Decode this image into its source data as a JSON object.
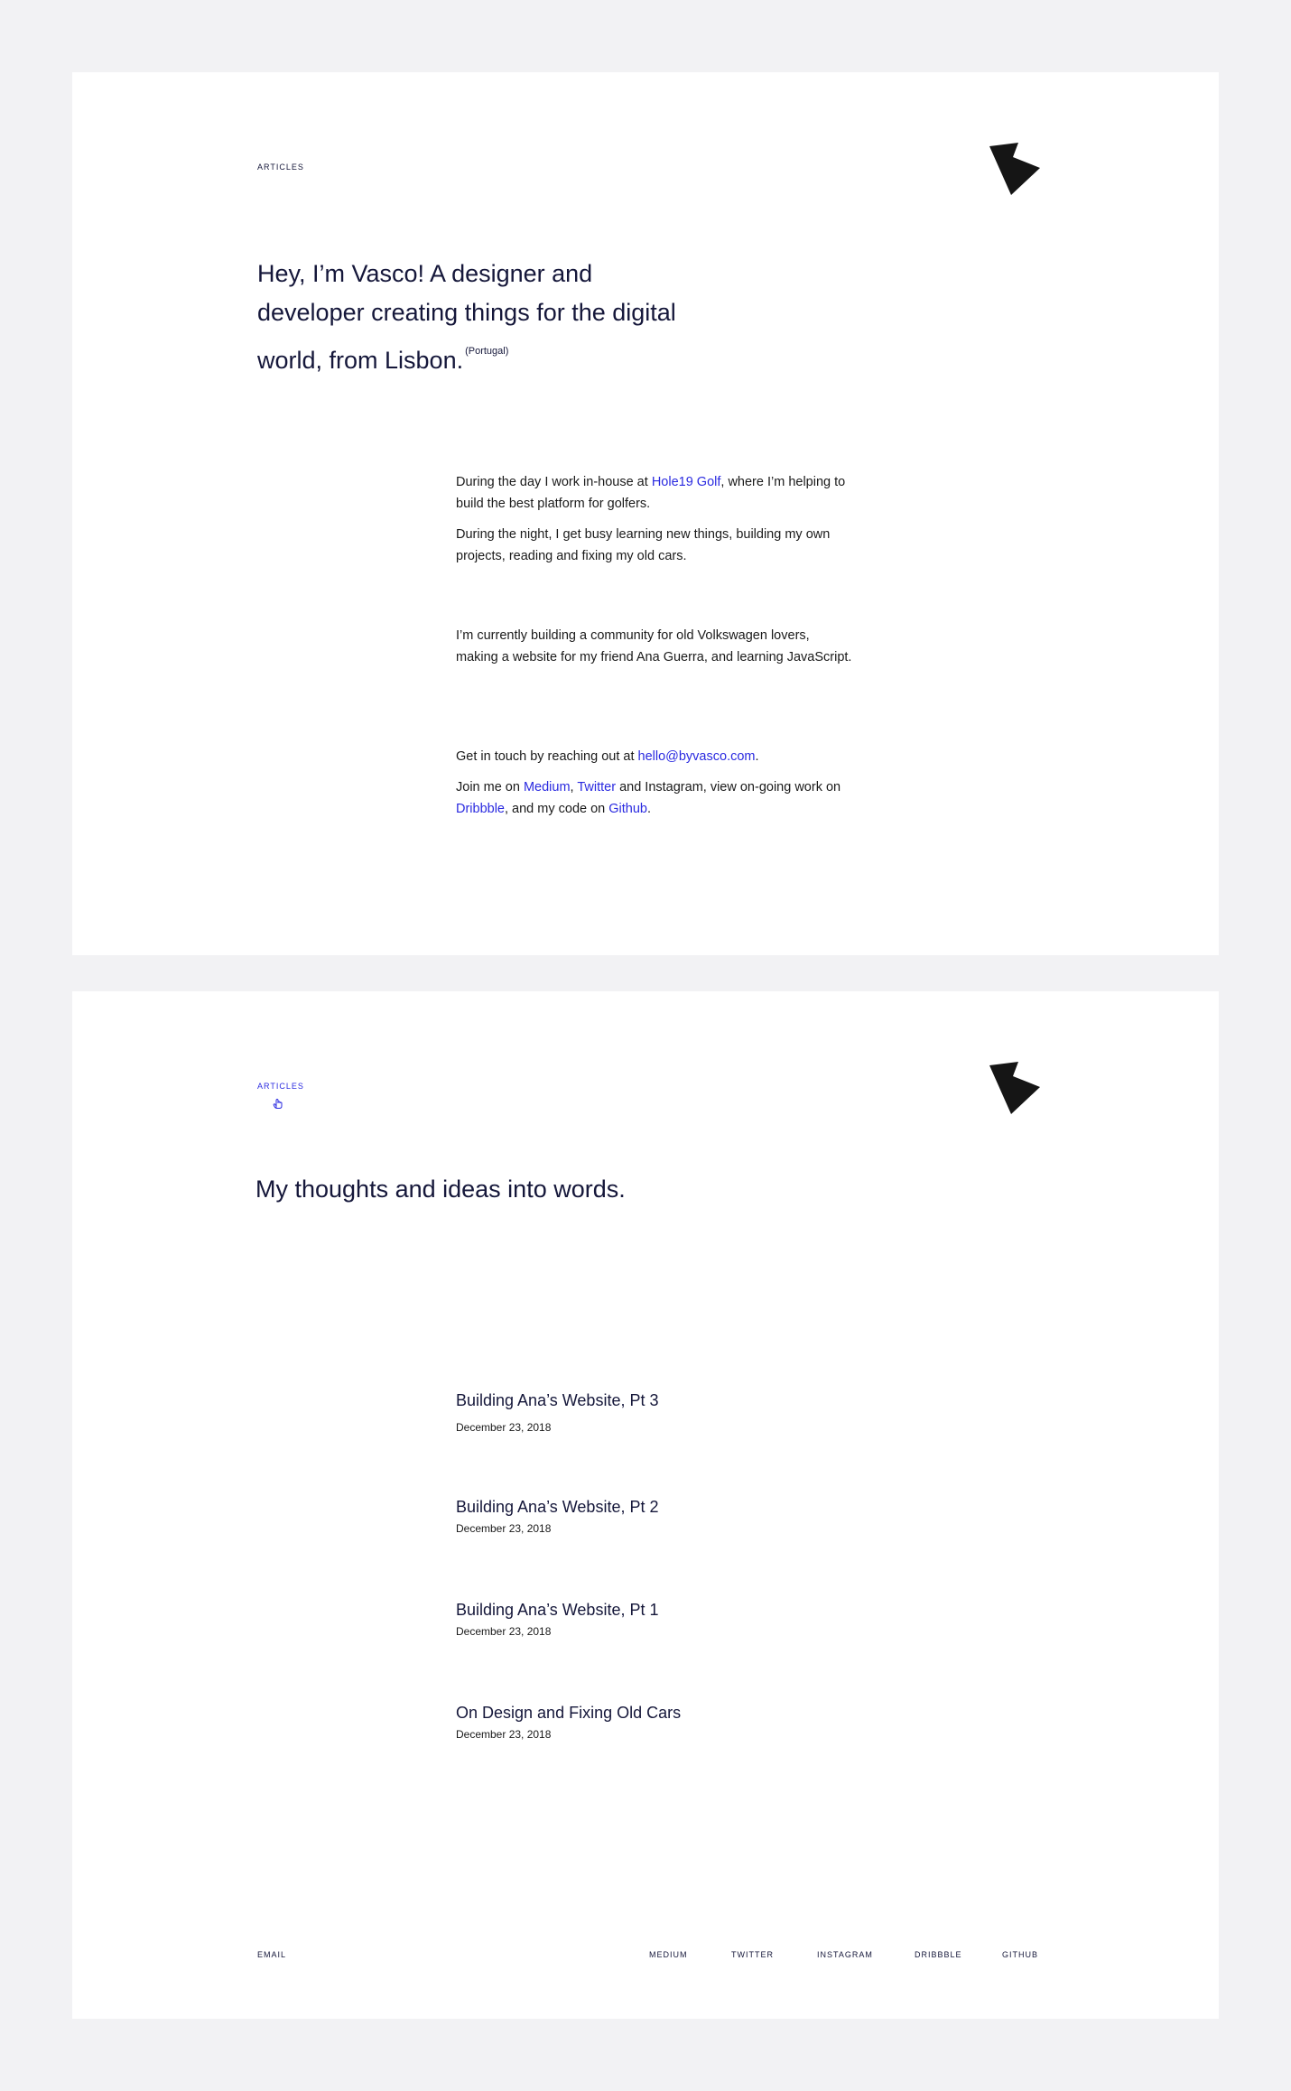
{
  "intro": {
    "nav_label": "ARTICLES",
    "logo_icon": "bird-arrow-logo-icon",
    "hero_text": "Hey, I’m Vasco! A designer and developer creating things for the digital world, from Lisbon.",
    "hero_sup": "(Portugal)",
    "p1": {
      "before": "During the day I work in-house at ",
      "link": "Hole19 Golf",
      "after": ", where I’m helping to build the best platform for golfers."
    },
    "p2": "During the night, I get busy learning new things, building my own projects, reading and fixing my old cars.",
    "p3": "I’m currently building a community for old Volkswagen lovers, making a website for my friend Ana Guerra, and learning JavaScript.",
    "p4": {
      "before": "Get in touch by reaching out at ",
      "link": "hello@byvasco.com",
      "after": "."
    },
    "p5": {
      "t1": "Join me on ",
      "medium": "Medium",
      "t2": ", ",
      "twitter": "Twitter",
      "t3": " and Instagram, view on-going work on ",
      "dribbble": "Dribbble",
      "t4": ", and my code on ",
      "github": "Github",
      "t5": "."
    }
  },
  "articles_page": {
    "nav_label": "ARTICLES",
    "cursor_icon": "hand-pointer-icon",
    "heading": "My thoughts and ideas into words.",
    "articles": [
      {
        "title": "Building Ana’s Website, Pt 3",
        "date": "December 23, 2018"
      },
      {
        "title": "Building Ana’s Website, Pt 2",
        "date": "December 23, 2018"
      },
      {
        "title": "Building Ana’s Website, Pt 1",
        "date": "December 23, 2018"
      },
      {
        "title": "On Design and Fixing Old Cars",
        "date": "December 23, 2018"
      }
    ],
    "footer": {
      "email": "EMAIL",
      "medium": "MEDIUM",
      "twitter": "TWITTER",
      "instagram": "INSTAGRAM",
      "dribbble": "DRIBBBLE",
      "github": "GITHUB"
    }
  },
  "colors": {
    "background": "#f2f2f4",
    "card": "#ffffff",
    "text": "#15173a",
    "link": "#2a2ae0",
    "logo": "#151515"
  }
}
